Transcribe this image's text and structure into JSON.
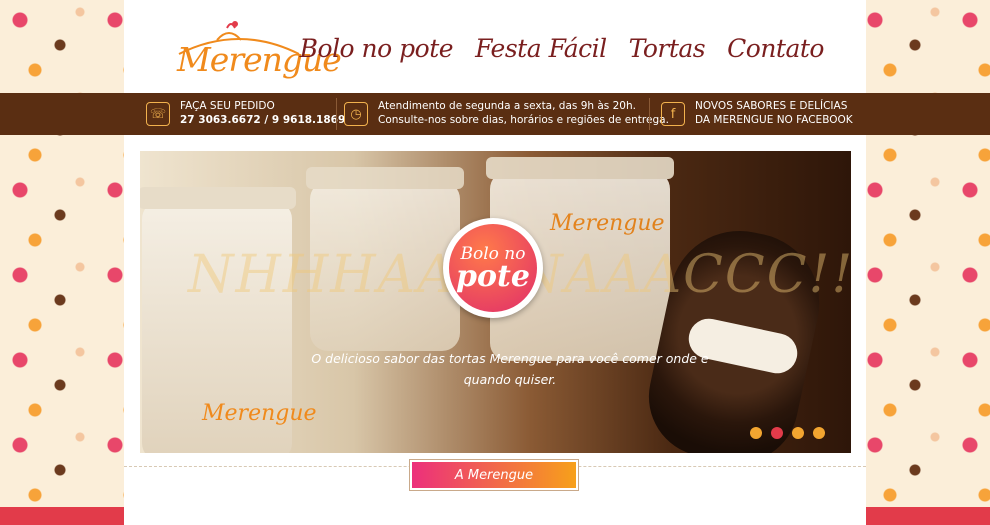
{
  "brand": {
    "name": "Merengue"
  },
  "nav": {
    "items": [
      "Bolo no pote",
      "Festa Fácil",
      "Tortas",
      "Contato"
    ]
  },
  "infobar": {
    "order": {
      "title": "FAÇA SEU PEDIDO",
      "phone1": "27 3063.6672",
      "sep": "/",
      "phone2": "9 9618.1869",
      "icon": "phone-icon"
    },
    "hours": {
      "line1": "Atendimento de segunda a sexta, das 9h às 20h.",
      "line2": "Consulte-nos sobre dias, horários e regiões de entrega.",
      "icon": "clock-icon"
    },
    "facebook": {
      "line1": "NOVOS SABORES E DELÍCIAS",
      "line2": "DA MERENGUE NO FACEBOOK",
      "icon": "facebook-icon"
    }
  },
  "hero": {
    "background_text": "NHHHAAC  NAAACCC!!",
    "badge": {
      "line1": "Bolo no",
      "line2": "pote"
    },
    "caption": "O delicioso sabor das tortas Merengue para você comer onde e quando quiser.",
    "slides": 4,
    "active_slide": 2
  },
  "section_tab": {
    "label": "A Merengue"
  },
  "colors": {
    "brown": "#5a2e12",
    "orange": "#f08a1c",
    "nav": "#7a1f1f",
    "pink": "#ec2f7c"
  }
}
